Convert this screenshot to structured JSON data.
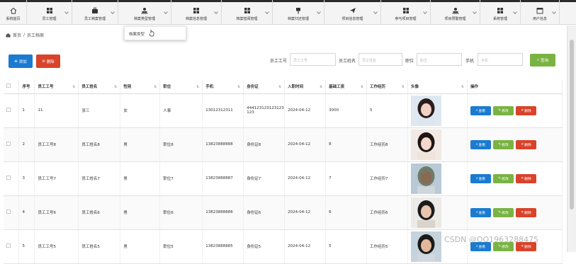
{
  "nav": {
    "items": [
      {
        "label": "系统首页",
        "icon": "home-icon"
      },
      {
        "label": "员工管理",
        "icon": "grid-icon"
      },
      {
        "label": "员工档案管理",
        "icon": "toolbox-icon"
      },
      {
        "label": "档案类型管理",
        "icon": "user-icon"
      },
      {
        "label": "档案信息管理",
        "icon": "grid-icon"
      },
      {
        "label": "档案借阅管理",
        "icon": "grid-icon"
      },
      {
        "label": "档案归还管理",
        "icon": "pin-icon"
      },
      {
        "label": "项目信息管理",
        "icon": "send-icon"
      },
      {
        "label": "参与项目管理",
        "icon": "grid-icon"
      },
      {
        "label": "项目预警管理",
        "icon": "user-icon"
      },
      {
        "label": "系统管理",
        "icon": "grid-icon"
      },
      {
        "label": "用户信息",
        "icon": "calendar-icon"
      }
    ]
  },
  "dropdown": {
    "option": "档案类型"
  },
  "breadcrumb": {
    "home": "首页",
    "sep": "/",
    "current": "员工档案"
  },
  "toolbar": {
    "add": "添加",
    "delete": "删除",
    "search": "查询",
    "filters": [
      {
        "label": "员工工号",
        "placeholder": "员工工号"
      },
      {
        "label": "员工姓名",
        "placeholder": "员工姓名"
      },
      {
        "label": "职位",
        "placeholder": "职位"
      },
      {
        "label": "手机",
        "placeholder": "手机"
      }
    ]
  },
  "table": {
    "headers": [
      "序号",
      "员工工号",
      "员工姓名",
      "性别",
      "职位",
      "手机",
      "身份证",
      "入职时间",
      "基础工资",
      "工作经历",
      "头像",
      "操作"
    ],
    "rows": [
      [
        "1",
        "11",
        "张三",
        "女",
        "人事",
        "13012312311",
        "444123123123123123",
        "2024-04-12",
        "3000",
        "5"
      ],
      [
        "2",
        "员工工号8",
        "员工姓名8",
        "男",
        "职位8",
        "13823888888",
        "身份证8",
        "2024-04-12",
        "8",
        "工作经历8"
      ],
      [
        "3",
        "员工工号7",
        "员工姓名7",
        "男",
        "职位7",
        "13823888887",
        "身份证7",
        "2024-04-12",
        "7",
        "工作经历7"
      ],
      [
        "4",
        "员工工号6",
        "员工姓名6",
        "男",
        "职位6",
        "13823888886",
        "身份证6",
        "2024-04-12",
        "6",
        "工作经历6"
      ],
      [
        "5",
        "员工工号5",
        "员工姓名5",
        "男",
        "职位5",
        "13823888885",
        "身份证5",
        "2024-04-12",
        "5",
        "工作经历5"
      ]
    ],
    "actions": {
      "view": "查看",
      "edit": "修改",
      "delete": "删除"
    }
  },
  "colors": {
    "primary": "#1a7bd0",
    "success": "#7ab343",
    "danger": "#d9432a",
    "topbar": "#2b2b2b"
  },
  "watermark": "CSDN @QQ1963288475"
}
